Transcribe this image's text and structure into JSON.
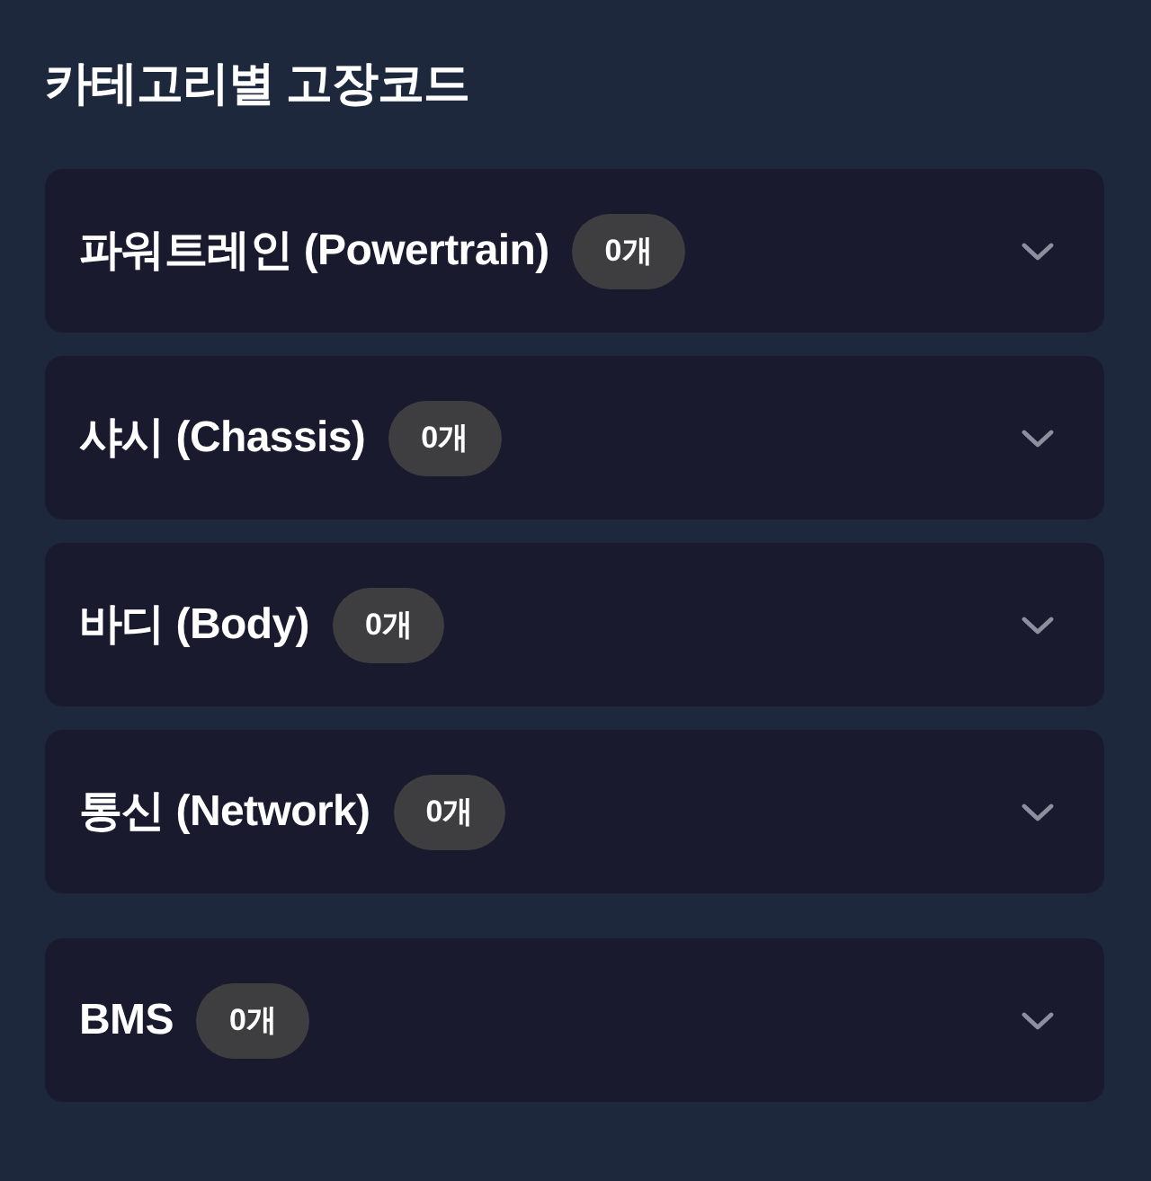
{
  "title": "카테고리별 고장코드",
  "sections": [
    {
      "items": [
        {
          "label": "파워트레인 (Powertrain)",
          "count": "0개",
          "expanded": false
        },
        {
          "label": "샤시 (Chassis)",
          "count": "0개",
          "expanded": false
        },
        {
          "label": "바디 (Body)",
          "count": "0개",
          "expanded": false
        },
        {
          "label": "통신 (Network)",
          "count": "0개",
          "expanded": false
        }
      ]
    },
    {
      "items": [
        {
          "label": "BMS",
          "count": "0개",
          "expanded": false
        }
      ]
    }
  ]
}
